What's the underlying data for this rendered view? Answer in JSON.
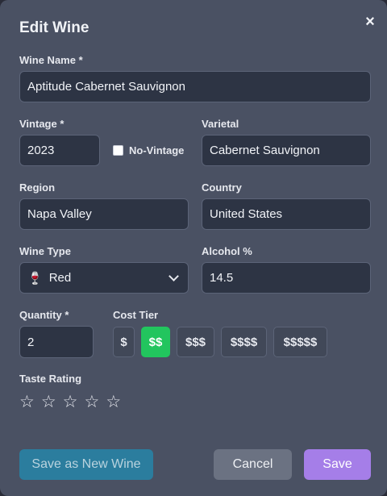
{
  "modal": {
    "title": "Edit Wine",
    "close_glyph": "×"
  },
  "wine_name": {
    "label": "Wine Name *",
    "value": "Aptitude Cabernet Sauvignon"
  },
  "vintage": {
    "label": "Vintage *",
    "value": "2023"
  },
  "no_vintage": {
    "label": "No-Vintage",
    "checked": false
  },
  "varietal": {
    "label": "Varietal",
    "value": "Cabernet Sauvignon"
  },
  "region": {
    "label": "Region",
    "value": "Napa Valley"
  },
  "country": {
    "label": "Country",
    "value": "United States"
  },
  "wine_type": {
    "label": "Wine Type",
    "selected": "Red",
    "icon": "wine-glass-icon",
    "icon_glyph": "🍷"
  },
  "alcohol": {
    "label": "Alcohol %",
    "value": "14.5"
  },
  "quantity": {
    "label": "Quantity *",
    "value": "2"
  },
  "cost_tier": {
    "label": "Cost Tier",
    "options": [
      "$",
      "$$",
      "$$$",
      "$$$$",
      "$$$$$"
    ],
    "selected": "$$",
    "active_color": "#22c55e"
  },
  "taste_rating": {
    "label": "Taste Rating",
    "star_glyph": "☆",
    "rating": 0,
    "max": 5
  },
  "actions": {
    "save_as_new": "Save as New Wine",
    "cancel": "Cancel",
    "save": "Save"
  },
  "colors": {
    "modal_bg": "#4a5163",
    "input_bg": "#2d3444",
    "save_as_new_bg": "#2b7d9e",
    "cancel_bg": "#6b7282",
    "save_bg": "#a57ee8"
  }
}
